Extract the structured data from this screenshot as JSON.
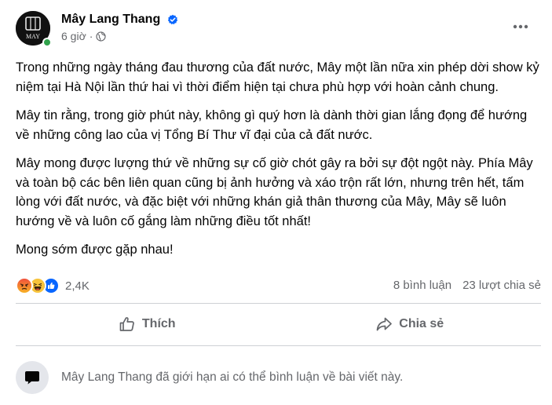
{
  "post": {
    "author": {
      "name": "Mây Lang Thang",
      "avatar_text": "MAY",
      "verified": true,
      "online": true
    },
    "time": "6 giờ",
    "privacy_icon": "globe-icon",
    "paragraphs": [
      "Trong những ngày tháng đau thương của đất nước, Mây một lần nữa xin phép dời show kỷ niệm tại Hà Nội lần thứ hai vì thời điểm hiện tại chưa phù hợp với hoàn cảnh chung.",
      "Mây tin rằng, trong giờ phút này, không gì quý hơn là dành thời gian lắng đọng để hướng về những công lao của vị Tổng Bí Thư vĩ đại của cả đất nước.",
      "Mây mong được lượng thứ về những sự cố giờ chót gây ra bởi sự đột ngột này. Phía Mây và toàn bộ các bên liên quan cũng bị ảnh hưởng và xáo trộn rất lớn, nhưng trên hết, tấm lòng với đất nước, và đặc biệt với những khán giả thân thương của Mây, Mây sẽ luôn hướng về và luôn cố gắng làm những điều tốt nhất!",
      "Mong sớm được gặp nhau!"
    ],
    "reactions": {
      "types": [
        "angry-icon",
        "haha-icon",
        "like-icon"
      ],
      "count": "2,4K"
    },
    "comments_count": "8 bình luận",
    "shares_count": "23 lượt chia sẻ",
    "actions": {
      "like_label": "Thích",
      "share_label": "Chia sẻ"
    },
    "restricted_notice": "Mây Lang Thang đã giới hạn ai có thể bình luận về bài viết này."
  },
  "colors": {
    "primary_text": "#050505",
    "secondary_text": "#65676b",
    "verified_blue": "#0866ff",
    "online_green": "#31a24c",
    "divider": "#ced0d4"
  }
}
